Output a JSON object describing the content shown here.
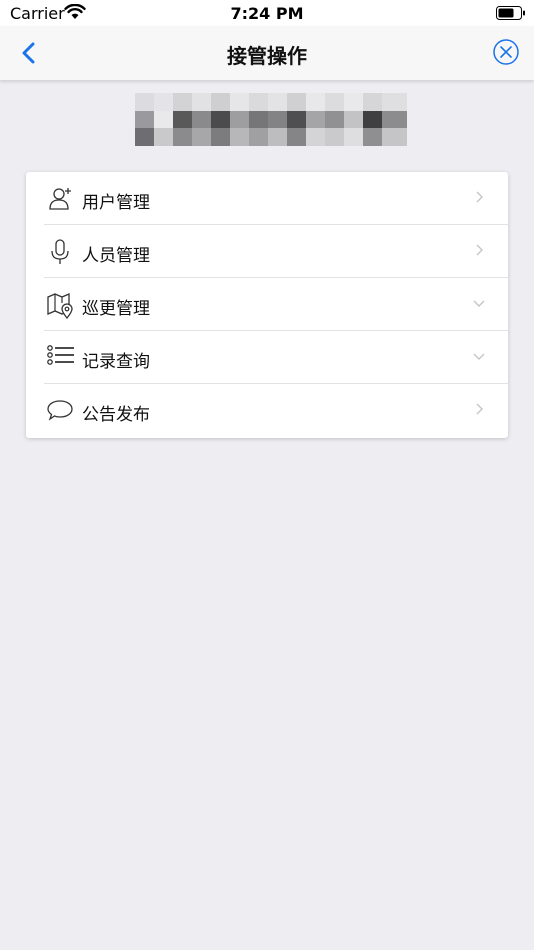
{
  "status_bar": {
    "carrier": "Carrier",
    "time": "7:24 PM"
  },
  "nav": {
    "title": "接管操作"
  },
  "site": {
    "name": "上"
  },
  "menu": {
    "items": [
      {
        "label": "用户管理",
        "icon": "user-add-icon",
        "chevron": "chevron-right-icon"
      },
      {
        "label": "人员管理",
        "icon": "microphone-icon",
        "chevron": "chevron-right-icon"
      },
      {
        "label": "巡更管理",
        "icon": "map-pin-icon",
        "chevron": "chevron-down-icon"
      },
      {
        "label": "记录查询",
        "icon": "list-icon",
        "chevron": "chevron-down-icon"
      },
      {
        "label": "公告发布",
        "icon": "speech-bubble-icon",
        "chevron": "chevron-right-icon"
      }
    ]
  },
  "colors": {
    "accent": "#1a73e8",
    "background": "#ededf2",
    "chevron": "#c4c4c9"
  }
}
